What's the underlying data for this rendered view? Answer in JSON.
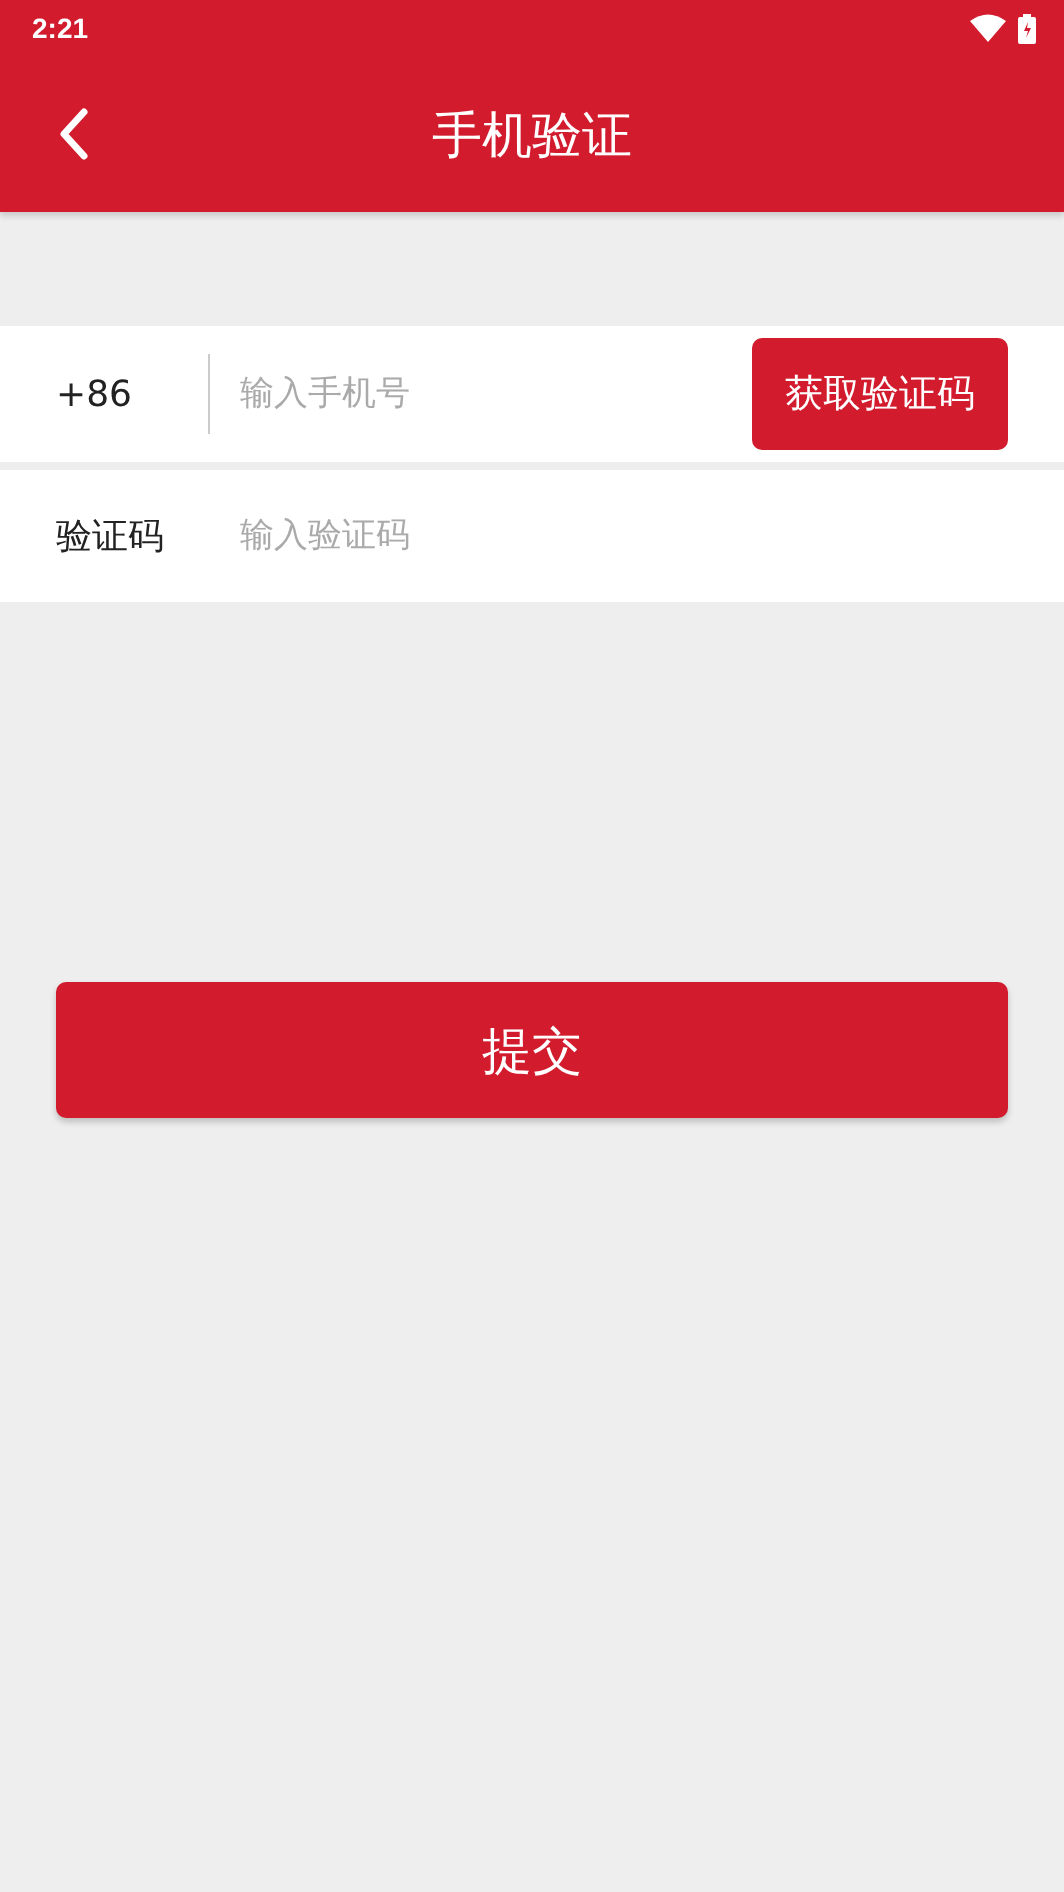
{
  "status_bar": {
    "time": "2:21"
  },
  "header": {
    "title": "手机验证"
  },
  "phone_row": {
    "prefix": "+86",
    "placeholder": "输入手机号",
    "button": "获取验证码"
  },
  "code_row": {
    "label": "验证码",
    "placeholder": "输入验证码"
  },
  "submit": {
    "label": "提交"
  }
}
